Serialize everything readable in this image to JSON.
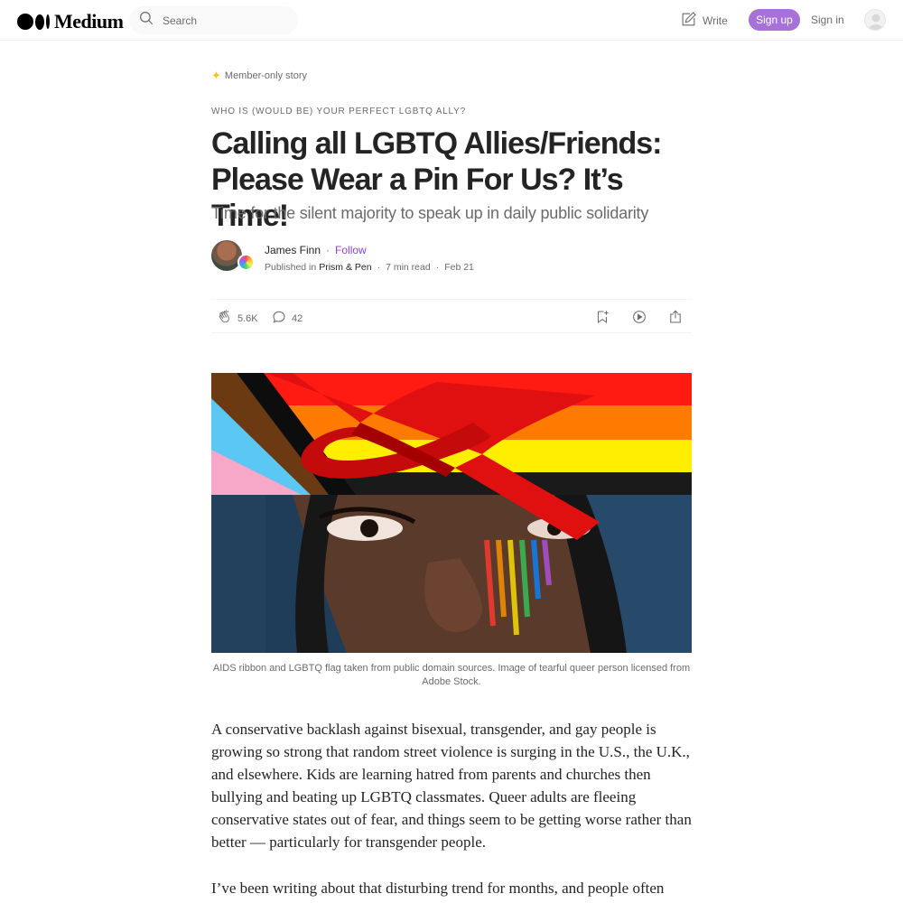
{
  "header": {
    "logo_text": "Medium",
    "search_placeholder": "Search",
    "write_label": "Write",
    "signup_label": "Sign up",
    "signin_label": "Sign in"
  },
  "article": {
    "member_label": "Member-only story",
    "kicker": "WHO IS (WOULD BE) YOUR PERFECT LGBTQ ALLY?",
    "title": "Calling all LGBTQ Allies/Friends: Please Wear a Pin For Us? It’s Time!",
    "subtitle": "Time for the silent majority to speak up in daily public solidarity",
    "author": {
      "name": "James Finn",
      "follow_label": "Follow",
      "published_in_label": "Published in",
      "publication": "Prism & Pen",
      "read_time": "7 min read",
      "date": "Feb 21"
    },
    "stats": {
      "claps": "5.6K",
      "responses": "42"
    },
    "image_caption": "AIDS ribbon and LGBTQ flag taken from public domain sources. Image of tearful queer person licensed from Adobe Stock.",
    "paragraphs": [
      "A conservative backlash against bisexual, transgender, and gay people is growing so strong that random street violence is surging in the U.S., the U.K., and elsewhere. Kids are learning hatred from parents and churches then bullying and beating up LGBTQ classmates. Queer adults are fleeing conservative states out of fear, and things seem to be getting worse rather than better — particularly for transgender people.",
      "I’ve been writing about that disturbing trend for months, and people often"
    ]
  },
  "colors": {
    "accent": "#a671d9",
    "follow": "#8b46c9",
    "member_star": "#ffc017",
    "text": "#242424",
    "muted": "#6b6b6b"
  },
  "icons": [
    "search-icon",
    "write-icon",
    "clap-icon",
    "comment-icon",
    "bookmark-icon",
    "listen-icon",
    "share-icon"
  ]
}
